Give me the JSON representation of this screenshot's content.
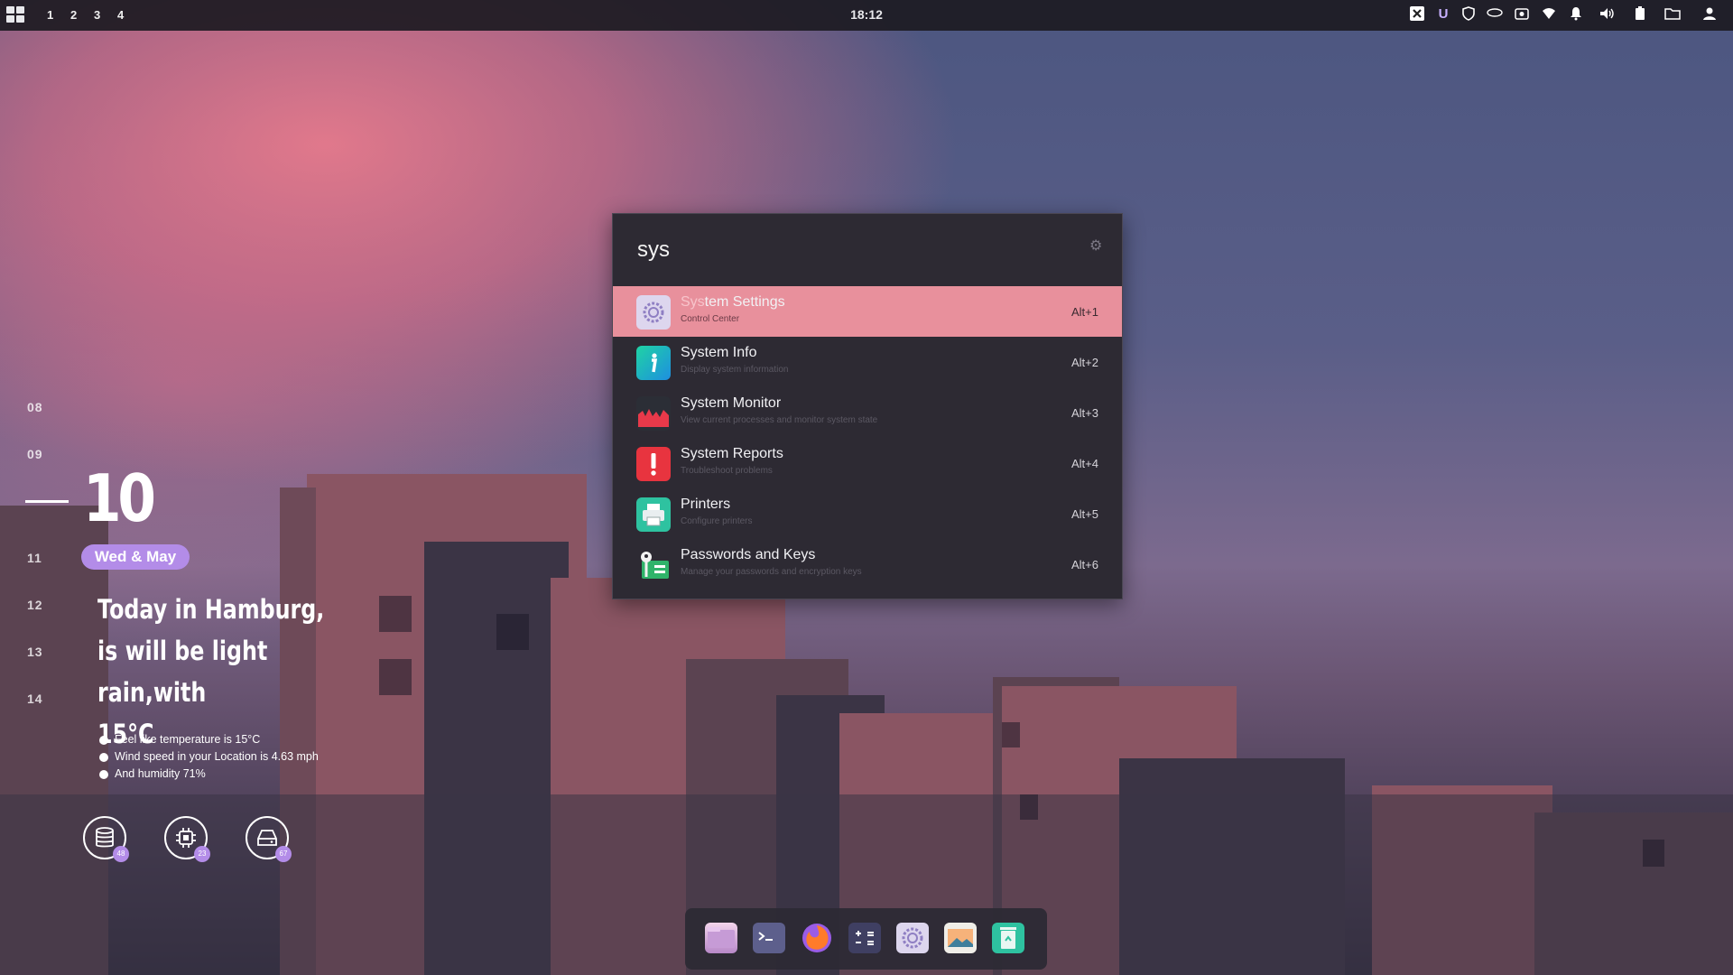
{
  "topbar": {
    "workspaces": [
      "1",
      "2",
      "3",
      "4"
    ],
    "clock": "18:12",
    "tray_icons": [
      "x-icon",
      "u-icon",
      "shield-icon",
      "cpu-chip-icon",
      "screenshot-icon",
      "wifi-icon",
      "bell-icon",
      "volume-icon",
      "battery-icon",
      "folder-icon",
      "user-icon"
    ]
  },
  "timeline": {
    "hours_above": [
      "08",
      "09"
    ],
    "current_hour": "10",
    "hours_below": [
      "11",
      "12",
      "13",
      "14"
    ],
    "date_label": "Wed & May"
  },
  "weather": {
    "line1": "Today in Hamburg,",
    "line2": "is will be light rain,with",
    "line3": "15°C",
    "details": [
      "Feel like temperature is 15°C",
      "Wind speed in your Location is 4.63 mph",
      "And humidity 71%"
    ],
    "stats": [
      {
        "icon": "database-icon",
        "badge": "48"
      },
      {
        "icon": "cpu-icon",
        "badge": "23"
      },
      {
        "icon": "storage-icon",
        "badge": "67"
      }
    ]
  },
  "launcher": {
    "query": "sys",
    "settings_icon": "gear-icon",
    "results": [
      {
        "highlight": "Sys",
        "rest": "tem Settings",
        "subtitle": "Control Center",
        "shortcut": "Alt+1",
        "icon": "settings-gear-icon"
      },
      {
        "highlight": "",
        "rest": "System Info",
        "subtitle": "Display system information",
        "shortcut": "Alt+2",
        "icon": "info-icon"
      },
      {
        "highlight": "",
        "rest": "System Monitor",
        "subtitle": "View current processes and monitor system state",
        "shortcut": "Alt+3",
        "icon": "monitor-chart-icon"
      },
      {
        "highlight": "",
        "rest": "System Reports",
        "subtitle": "Troubleshoot problems",
        "shortcut": "Alt+4",
        "icon": "alert-icon"
      },
      {
        "highlight": "",
        "rest": "Printers",
        "subtitle": "Configure printers",
        "shortcut": "Alt+5",
        "icon": "printer-icon"
      },
      {
        "highlight": "",
        "rest": "Passwords and Keys",
        "subtitle": "Manage your passwords and encryption keys",
        "shortcut": "Alt+6",
        "icon": "key-icon"
      }
    ]
  },
  "dock": {
    "apps": [
      "files-icon",
      "terminal-icon",
      "firefox-icon",
      "calculator-icon",
      "settings-icon",
      "image-viewer-icon",
      "trash-icon"
    ]
  }
}
